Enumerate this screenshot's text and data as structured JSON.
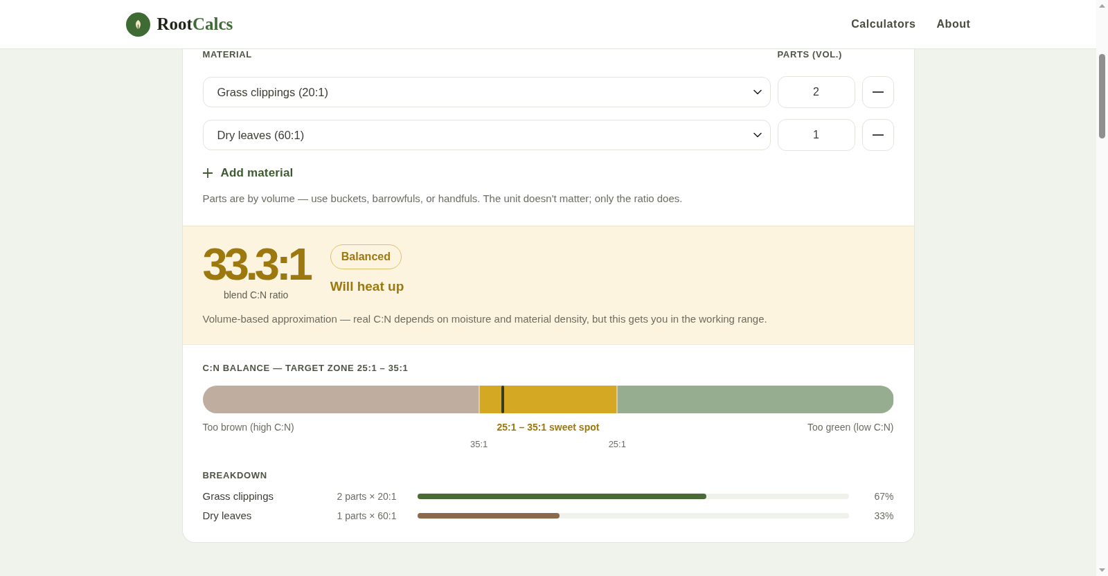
{
  "header": {
    "brand": {
      "primary": "Root",
      "accent": "Calcs"
    },
    "nav": [
      {
        "label": "Calculators"
      },
      {
        "label": "About"
      }
    ]
  },
  "materials": {
    "columns": [
      "MATERIAL",
      "PARTS (VOL.)"
    ],
    "rows": [
      {
        "material": "Grass clippings (20:1)",
        "parts": "2"
      },
      {
        "material": "Dry leaves (60:1)",
        "parts": "1"
      }
    ],
    "add_label": "Add material",
    "hint": "Parts are by volume — use buckets, barrowfuls, or handfuls. The unit doesn't matter; only the ratio does."
  },
  "result": {
    "ratio": "33.3:1",
    "caption": "blend C:N ratio",
    "badge": "Balanced",
    "verdict": "Will heat up",
    "note": "Volume-based approximation — real C:N depends on moisture and material density, but this gets you in the working range."
  },
  "balance": {
    "title": "C:N BALANCE — TARGET ZONE 25:1 – 35:1",
    "marker": {
      "level": 0.434
    },
    "zones": [
      {
        "kind": "outside",
        "label": "Too brown (high C:N)",
        "color": "#bfae9f"
      },
      {
        "kind": "target",
        "label": "25:1 – 35:1 sweet spot",
        "color": "#d4a823"
      },
      {
        "kind": "outside",
        "label": "Too green (low C:N)",
        "color": "#97ad8f"
      }
    ],
    "ticks": [
      {
        "label": "35:1",
        "level": 0.4
      },
      {
        "label": "25:1",
        "level": 0.6
      }
    ]
  },
  "breakdown": {
    "title": "BREAKDOWN",
    "rows": [
      {
        "name": "Grass clippings",
        "detail": "2 parts × 20:1",
        "level": 0.67,
        "color": "#4a6b35",
        "percent": "67%"
      },
      {
        "name": "Dry leaves",
        "detail": "1 parts × 60:1",
        "level": 0.33,
        "color": "#8a6a4a",
        "percent": "33%"
      }
    ]
  }
}
